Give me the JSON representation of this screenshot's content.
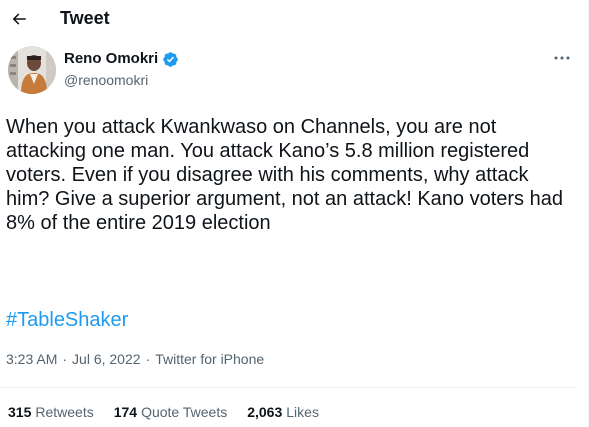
{
  "header": {
    "title": "Tweet",
    "back_icon": "arrow-left-icon"
  },
  "author": {
    "display_name": "Reno Omokri",
    "handle": "@renoomokri",
    "verified_color": "#1d9bf0",
    "verified_icon": "verified-badge-icon",
    "more_icon": "more-horizontal-icon"
  },
  "tweet": {
    "text": "When you attack Kwankwaso on Channels, you are not attacking one man. You attack Kano’s 5.8 million registered voters. Even if you disagree with his comments, why attack him? Give a superior argument, not an attack! Kano voters had 8% of the entire 2019 election",
    "hashtag": "#TableShaker",
    "time": "3:23 AM",
    "date": "Jul 6, 2022",
    "source": "Twitter for iPhone",
    "link_color": "#1d9bf0"
  },
  "stats": {
    "retweets_count": "315",
    "retweets_label": "Retweets",
    "quotes_count": "174",
    "quotes_label": "Quote Tweets",
    "likes_count": "2,063",
    "likes_label": "Likes"
  }
}
